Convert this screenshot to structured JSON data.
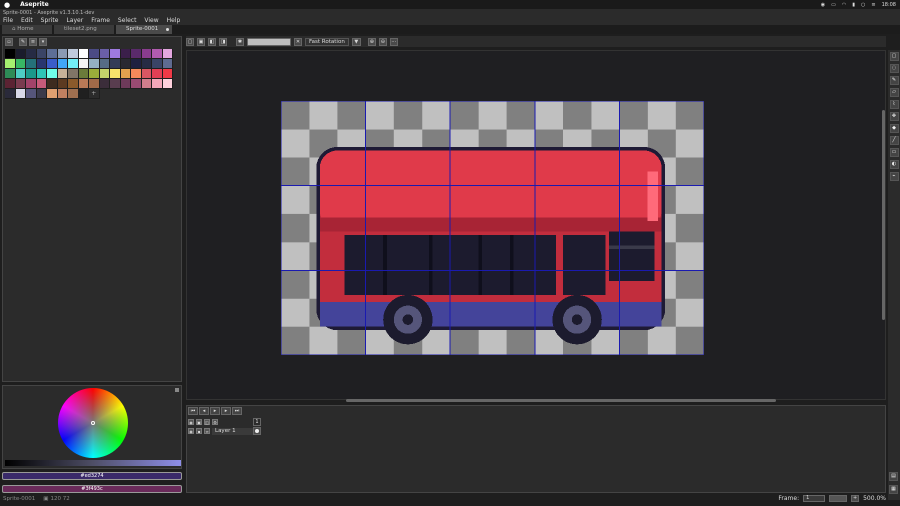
{
  "os": {
    "app_name": "Aseprite",
    "clock": "18:08"
  },
  "window": {
    "title": "Sprite-0001 - Aseprite v1.3.10.1-dev"
  },
  "menu": [
    "File",
    "Edit",
    "Sprite",
    "Layer",
    "Frame",
    "Select",
    "View",
    "Help"
  ],
  "tabs": [
    {
      "label": "Home",
      "active": false
    },
    {
      "label": "tileset2.png",
      "active": false
    },
    {
      "label": "Sprite-0001",
      "active": true
    }
  ],
  "context_bar": {
    "rotation_algorithm": "Fast Rotation",
    "dropdown_glyph": "▼"
  },
  "palette": {
    "colors": [
      "#000000",
      "#1a1c2c",
      "#262b44",
      "#3a4466",
      "#5d6e96",
      "#8b9bb4",
      "#c0cbdc",
      "#ffffff",
      "#4b4b85",
      "#6a5fa8",
      "#9e7ae0",
      "#3b1f4a",
      "#5a2a6b",
      "#8a3c8f",
      "#b25bb0",
      "#e4a7e0",
      "#a7f070",
      "#38b764",
      "#257179",
      "#29366f",
      "#3b5dc9",
      "#41a6f6",
      "#73eff7",
      "#f4f4f4",
      "#94b0c2",
      "#566c86",
      "#333c57",
      "#292831",
      "#1f2040",
      "#262b44",
      "#3a4466",
      "#5f6b91",
      "#2e8b57",
      "#4ecdc4",
      "#1b998b",
      "#2ec4b6",
      "#6fffe9",
      "#c7b198",
      "#817567",
      "#6b7b3a",
      "#9aad3a",
      "#c4d36b",
      "#f7e26b",
      "#e3a14f",
      "#f58a5b",
      "#d95763",
      "#e04055",
      "#f03a47",
      "#5b2333",
      "#7a3b4f",
      "#a2436a",
      "#c75b7a",
      "#3d2b1f",
      "#5c3a21",
      "#8b5a2b",
      "#b97a57",
      "#a06a48",
      "#3b2d3a",
      "#593d4f",
      "#6e3a5a",
      "#9a4b72",
      "#d27d8c",
      "#f4a7b9",
      "#ffd1dc",
      "#2a2a3a",
      "#d8d8e8",
      "#55557a",
      "#3a3a4a",
      "#e0a070",
      "#c08060",
      "#a07050",
      "#202020"
    ],
    "add_glyph": "+"
  },
  "color_bar": {
    "foreground_hex": "#ed3274",
    "background_hex": "#3f493c"
  },
  "status": {
    "sprite_name": "Sprite-0001",
    "canvas_size": "120 72",
    "frame_label": "Frame:",
    "frame_value": "1",
    "zoom": "500.0%"
  },
  "timeline": {
    "layer_name": "Layer 1",
    "frame_number": "1"
  },
  "colors": {
    "accent": "#ed3274"
  }
}
